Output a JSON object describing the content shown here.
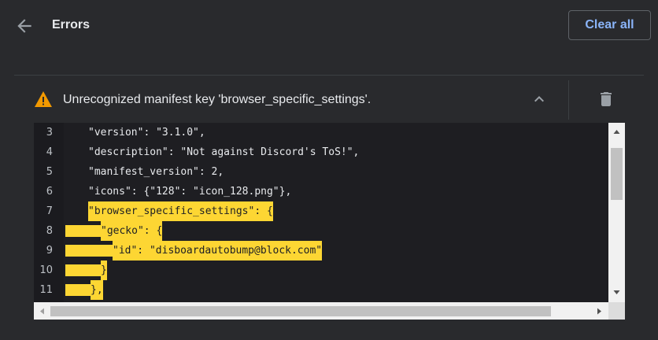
{
  "header": {
    "title": "Errors",
    "clear_all_label": "Clear all"
  },
  "error": {
    "message": "Unrecognized manifest key 'browser_specific_settings'."
  },
  "code": {
    "lines": [
      {
        "num": "3",
        "text": "\"version\": \"3.1.0\","
      },
      {
        "num": "4",
        "text": "\"description\": \"Not against Discord's ToS!\","
      },
      {
        "num": "5",
        "text": "\"manifest_version\": 2,"
      },
      {
        "num": "6",
        "text": "\"icons\": {\"128\": \"icon_128.png\"},"
      },
      {
        "num": "7",
        "text": "\"browser_specific_settings\": {"
      },
      {
        "num": "8",
        "text": "\"gecko\": {"
      },
      {
        "num": "9",
        "text": "\"id\": \"disboardautobump@block.com\""
      },
      {
        "num": "10",
        "text": "}"
      },
      {
        "num": "11",
        "text": "},"
      }
    ]
  },
  "colors": {
    "accent": "#8ab4f8",
    "warning": "#f29900",
    "highlight": "#fdd633"
  }
}
